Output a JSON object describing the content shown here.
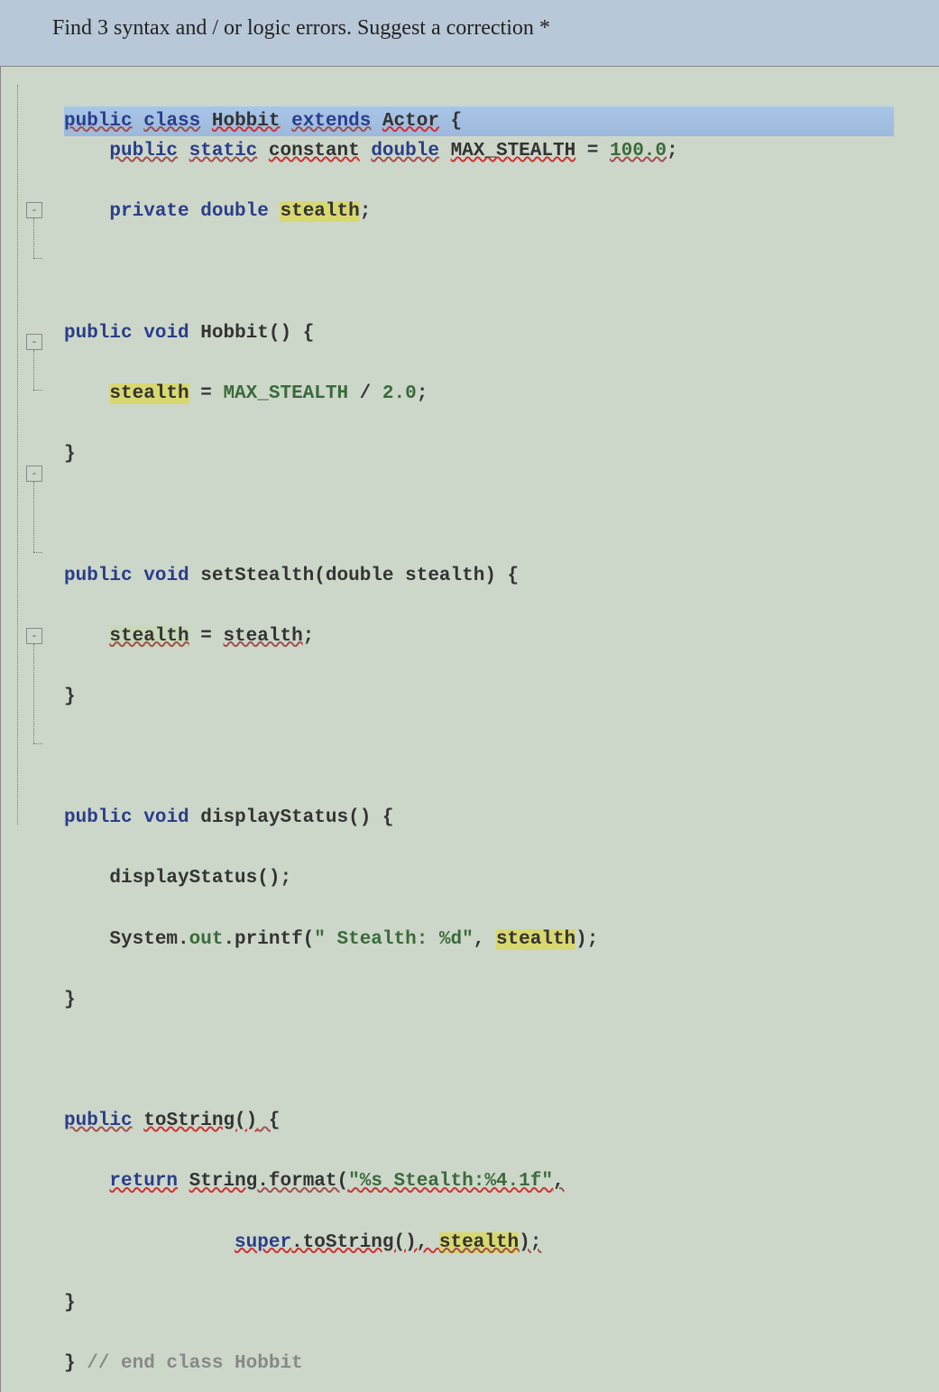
{
  "question": "Find 3 syntax and / or logic errors. Suggest a correction *",
  "code": {
    "line1": {
      "kw_public": "public",
      "kw_class": "class",
      "classname": "Hobbit",
      "kw_extends": "extends",
      "superclass": "Actor",
      "brace": "{"
    },
    "line2": {
      "kw_public": "public",
      "kw_static": "static",
      "kw_constant": "constant",
      "kw_double": "double",
      "name": "MAX_STEALTH",
      "eq": " = ",
      "val": "100.0",
      "semi": ";"
    },
    "line3": {
      "kw_private": "private",
      "kw_double": "double",
      "name": "stealth",
      "semi": ";"
    },
    "line5": {
      "kw_public": "public",
      "kw_void": "void",
      "name": "Hobbit()",
      "brace": " {"
    },
    "line6": {
      "lhs": "stealth",
      "eq": " = ",
      "rhs": "MAX_STEALTH",
      "div": " / ",
      "val": "2.0",
      "semi": ";"
    },
    "line7": {
      "brace": "}"
    },
    "line9": {
      "kw_public": "public",
      "kw_void": "void",
      "name": "setStealth",
      "params": "(double stealth)",
      "brace": " {"
    },
    "line10": {
      "lhs": "stealth",
      "eq": " = ",
      "rhs": "stealth",
      "semi": ";"
    },
    "line11": {
      "brace": "}"
    },
    "line13": {
      "kw_public": "public",
      "kw_void": "void",
      "name": "displayStatus()",
      "brace": " {"
    },
    "line14": {
      "call": "displayStatus();"
    },
    "line15": {
      "sys": "System.",
      "out": "out",
      "printf": ".printf(",
      "str": "\" Stealth: %d\"",
      "comma": ", ",
      "arg": "stealth",
      "close": ");"
    },
    "line16": {
      "brace": "}"
    },
    "line18": {
      "kw_public": "public",
      "name": "toString()",
      "brace": " {"
    },
    "line19": {
      "kw_return": "return",
      "sp": " ",
      "strcls": "String",
      "fmt": ".format(",
      "str": "\"%s Stealth:%4.1f\"",
      "comma": ","
    },
    "line20": {
      "superc": "super",
      "tostr": ".toString(), ",
      "arg": "stealth",
      "close": ");"
    },
    "line21": {
      "brace": "}"
    },
    "line22": {
      "brace": "}",
      "comment": " // end class Hobbit"
    }
  },
  "fold_glyph": "-"
}
